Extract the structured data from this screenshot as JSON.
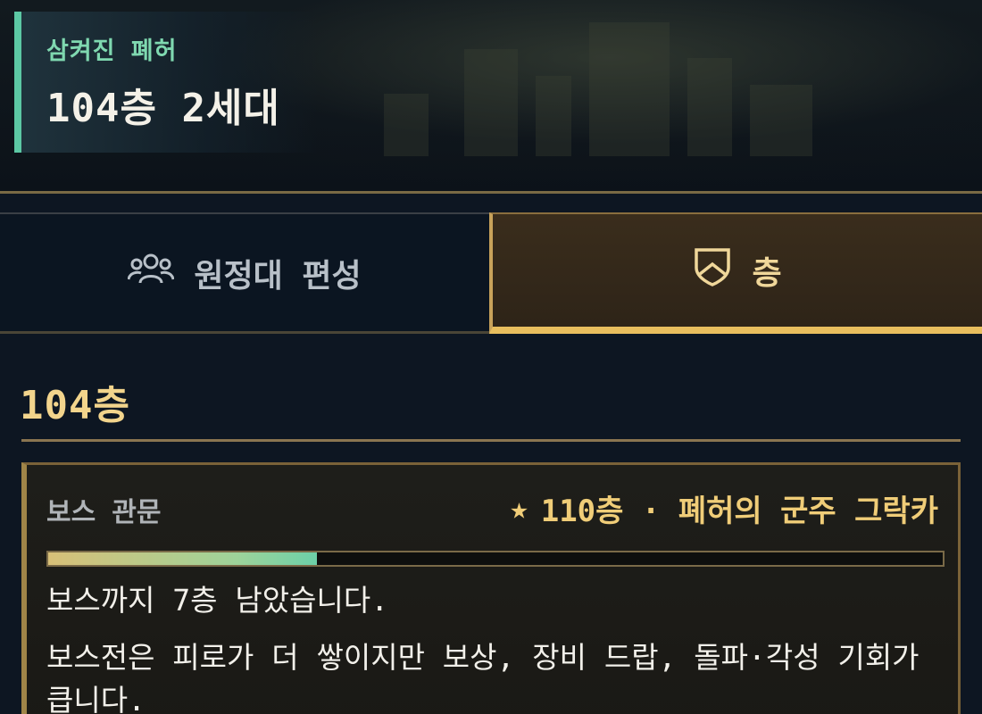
{
  "header": {
    "subtitle": "삼켜진 폐허",
    "title": "104층 2세대"
  },
  "tabs": [
    {
      "label": "원정대 편성",
      "icon": "people-icon",
      "selected": false
    },
    {
      "label": "층",
      "icon": "shield-icon",
      "selected": true
    }
  ],
  "floor": {
    "title": "104층"
  },
  "boss_card": {
    "label": "보스 관문",
    "boss_info": "110층 · 폐허의 군주 그락카",
    "progress": 0.3,
    "line1": "보스까지 7층 남았습니다.",
    "line2": "보스전은 피로가 더 쌓이지만 보상, 장비 드랍, 돌파·각성 기회가 큽니다."
  },
  "colors": {
    "accent_teal": "#5cc8a4",
    "accent_gold": "#e8be5e",
    "text_gold": "#f0cd78"
  }
}
